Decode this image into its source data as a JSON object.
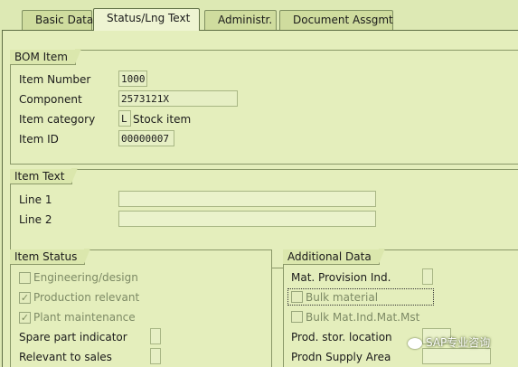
{
  "tabs": [
    {
      "label": "Basic Data",
      "active": false
    },
    {
      "label": "Status/Lng Text",
      "active": true
    },
    {
      "label": "Administr.",
      "active": false
    },
    {
      "label": "Document Assgmt",
      "active": false
    }
  ],
  "bom_item": {
    "title": "BOM Item",
    "item_number_label": "Item Number",
    "item_number_value": "1000",
    "component_label": "Component",
    "component_value": "2573121X",
    "item_category_label": "Item category",
    "item_category_code": "L",
    "item_category_text": "Stock item",
    "item_id_label": "Item ID",
    "item_id_value": "00000007"
  },
  "item_text": {
    "title": "Item Text",
    "line1_label": "Line 1",
    "line1_value": "",
    "line2_label": "Line 2",
    "line2_value": ""
  },
  "item_status": {
    "title": "Item Status",
    "engineering_label": "Engineering/design",
    "engineering_checked": false,
    "production_label": "Production relevant",
    "production_checked": true,
    "plant_maintenance_label": "Plant maintenance",
    "plant_maintenance_checked": true,
    "spare_part_label": "Spare part indicator",
    "relevant_sales_label": "Relevant to sales"
  },
  "additional_data": {
    "title": "Additional Data",
    "mat_provision_label": "Mat. Provision Ind.",
    "bulk_material_label": "Bulk material",
    "bulk_material_checked": false,
    "bulk_mat_ind_label": "Bulk Mat.Ind.Mat.Mst",
    "bulk_mat_ind_checked": false,
    "prod_stor_label": "Prod. stor. location",
    "prodn_supply_label": "Prodn Supply Area"
  },
  "watermark": {
    "text": "SAP专业咨询"
  }
}
